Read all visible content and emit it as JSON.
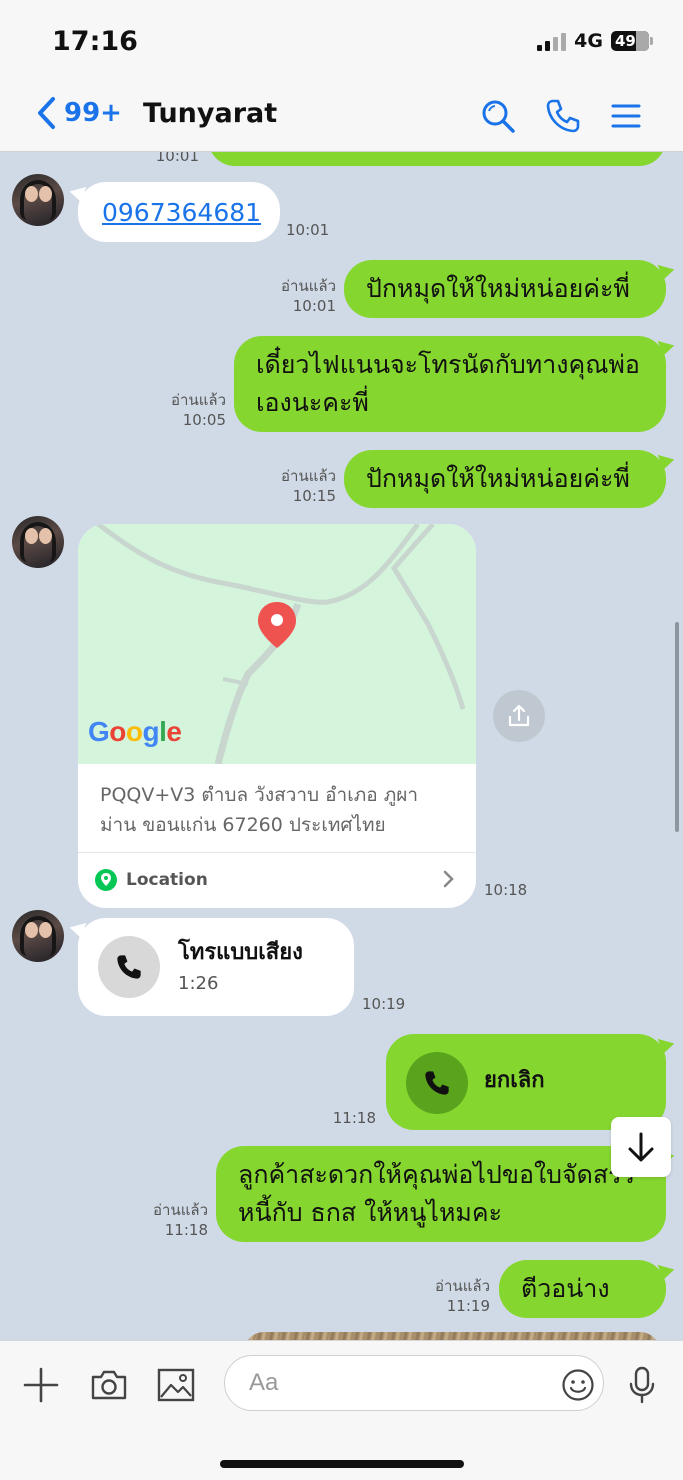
{
  "status": {
    "time": "17:16",
    "network": "4G",
    "battery": "49"
  },
  "header": {
    "back_count": "99+",
    "title": "Tunyarat"
  },
  "messages": {
    "m0_time": "10:01",
    "m1": {
      "text": "0967364681",
      "time": "10:01"
    },
    "m2": {
      "read": "อ่านแล้ว",
      "time": "10:01",
      "text": "ปักหมุดให้ใหม่หน่อยค่ะพี่"
    },
    "m3": {
      "read": "อ่านแล้ว",
      "time": "10:05",
      "line1": "เดี๋ยวไฟแนนจะโทรนัดกับทางคุณพ่อ",
      "line2": "เองนะคะพี่"
    },
    "m4": {
      "read": "อ่านแล้ว",
      "time": "10:15",
      "text": "ปักหมุดให้ใหม่หน่อยค่ะพี่"
    },
    "m5": {
      "map_logo": "Google",
      "address_line1": "PQQV+V3 ตำบล วังสวาบ อำเภอ ภูผา",
      "address_line2": "ม่าน ขอนแก่น 67260 ประเทศไทย",
      "location_label": "Location",
      "time": "10:18"
    },
    "m6": {
      "title": "โทรแบบเสียง",
      "duration": "1:26",
      "time": "10:19"
    },
    "m7": {
      "text": "ยกเลิก",
      "time": "11:18"
    },
    "m8": {
      "read": "อ่านแล้ว",
      "time": "11:18",
      "line1": "ลูกค้าสะดวกให้คุณพ่อไปขอใบจัดสรร",
      "line2": "หนี้กับ ธกส ให้หนูไหมคะ"
    },
    "m9": {
      "read": "อ่านแล้ว",
      "time": "11:19",
      "text": "ตีวอน่าง"
    }
  },
  "composer": {
    "placeholder": "Aa"
  },
  "colors": {
    "accent": "#1a73e8",
    "outgoing": "#86d630",
    "background": "#d0dae6"
  }
}
